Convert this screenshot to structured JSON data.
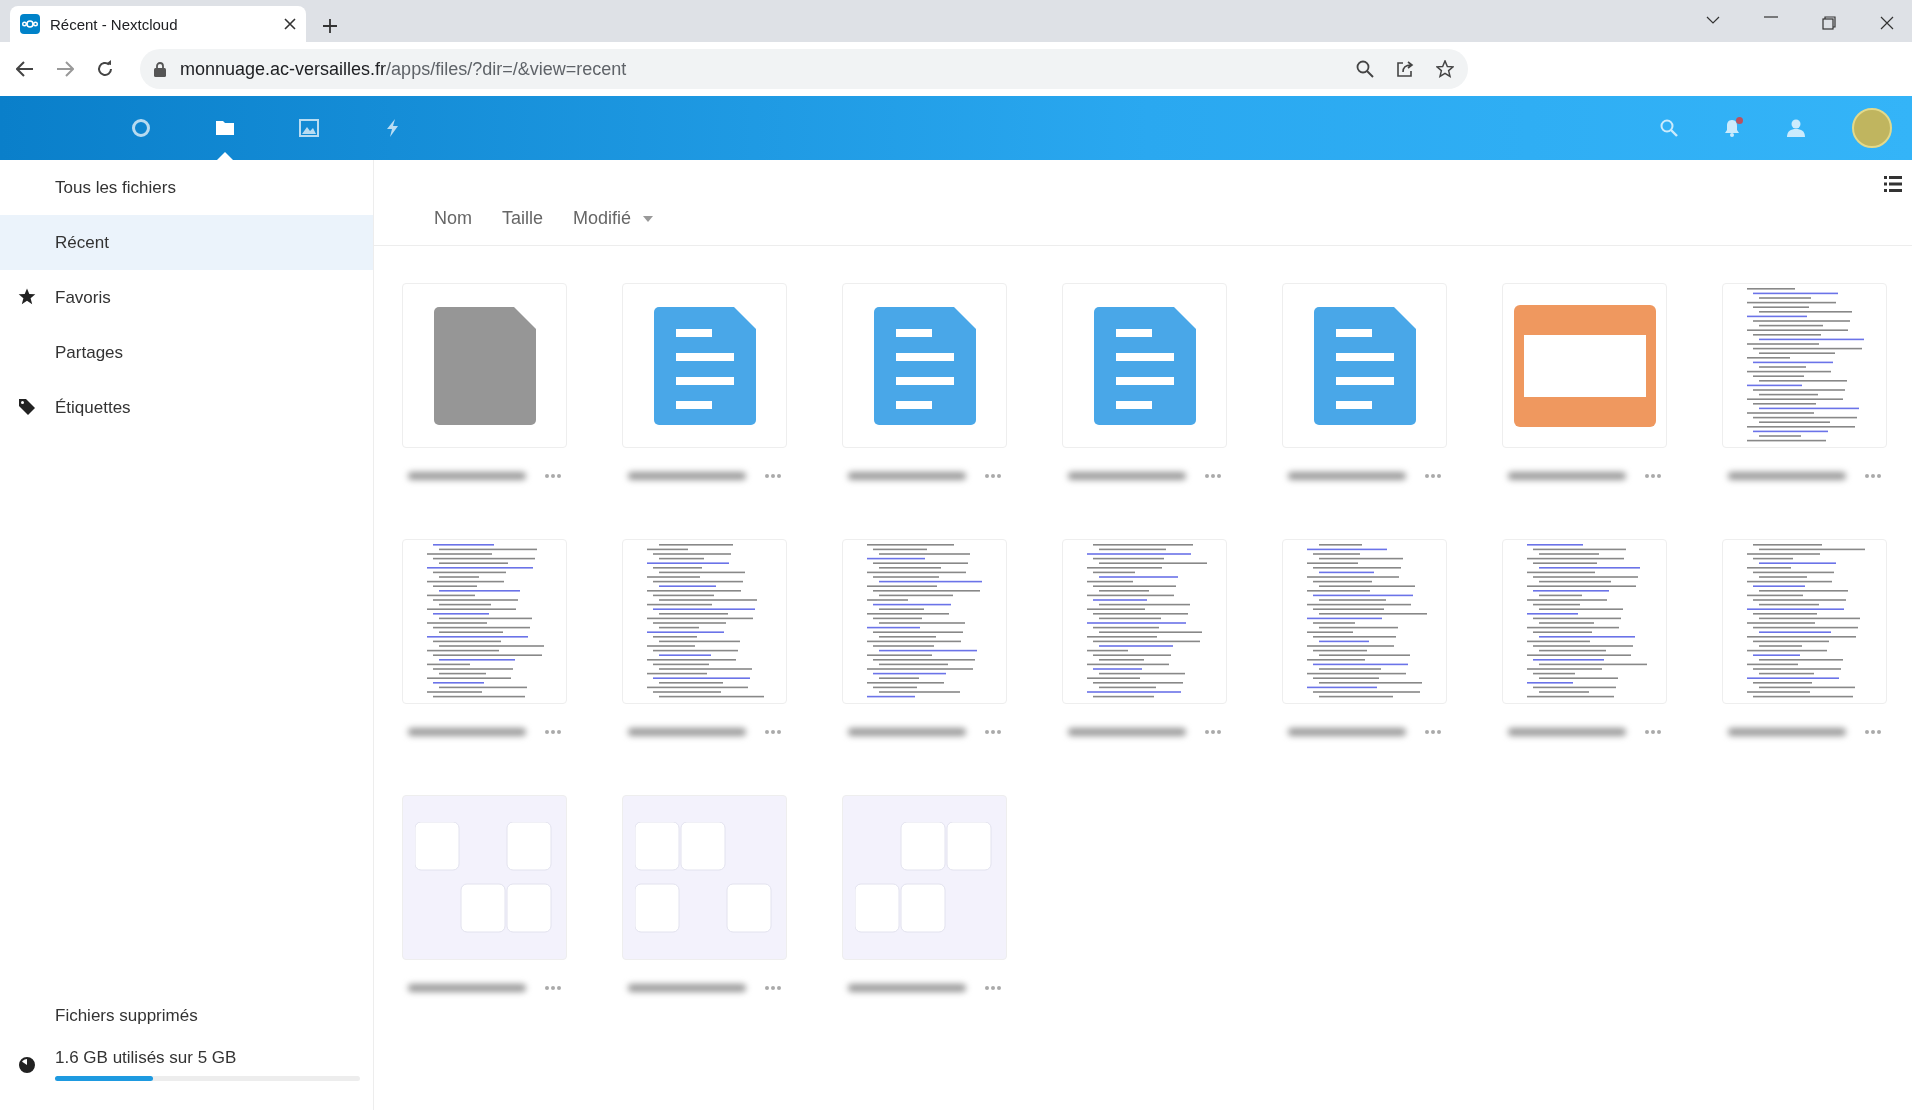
{
  "browser": {
    "tab_title": "Récent - Nextcloud",
    "url_host": "monnuage.ac-versailles.fr",
    "url_path": "/apps/files/?dir=/&view=recent"
  },
  "app_nav": [
    {
      "kind": "dashboard",
      "selected": false
    },
    {
      "kind": "files",
      "selected": true
    },
    {
      "kind": "photos",
      "selected": false
    },
    {
      "kind": "activity",
      "selected": false
    }
  ],
  "header_right": {
    "notification_unread": true
  },
  "sidebar": {
    "items": [
      {
        "label": "Tous les fichiers",
        "kind": "plain",
        "selected": false
      },
      {
        "label": "Récent",
        "kind": "plain",
        "selected": true
      },
      {
        "label": "Favoris",
        "kind": "star",
        "selected": false
      },
      {
        "label": "Partages",
        "kind": "plain",
        "selected": false
      },
      {
        "label": "Étiquettes",
        "kind": "tag",
        "selected": false
      }
    ],
    "deleted_files": "Fichiers supprimés",
    "storage": {
      "text": "1.6 GB utilisés sur 5 GB",
      "level": 0.32
    }
  },
  "sort_columns": [
    {
      "label": "Nom",
      "sorted": false
    },
    {
      "label": "Taille",
      "sorted": false
    },
    {
      "label": "Modifié",
      "sorted": true
    }
  ],
  "files": [
    {
      "kind": "generic"
    },
    {
      "kind": "document"
    },
    {
      "kind": "document"
    },
    {
      "kind": "document"
    },
    {
      "kind": "document"
    },
    {
      "kind": "presentation"
    },
    {
      "kind": "code"
    },
    {
      "kind": "code"
    },
    {
      "kind": "code"
    },
    {
      "kind": "code"
    },
    {
      "kind": "code"
    },
    {
      "kind": "code"
    },
    {
      "kind": "code"
    },
    {
      "kind": "code"
    },
    {
      "kind": "image"
    },
    {
      "kind": "image"
    },
    {
      "kind": "image"
    }
  ]
}
